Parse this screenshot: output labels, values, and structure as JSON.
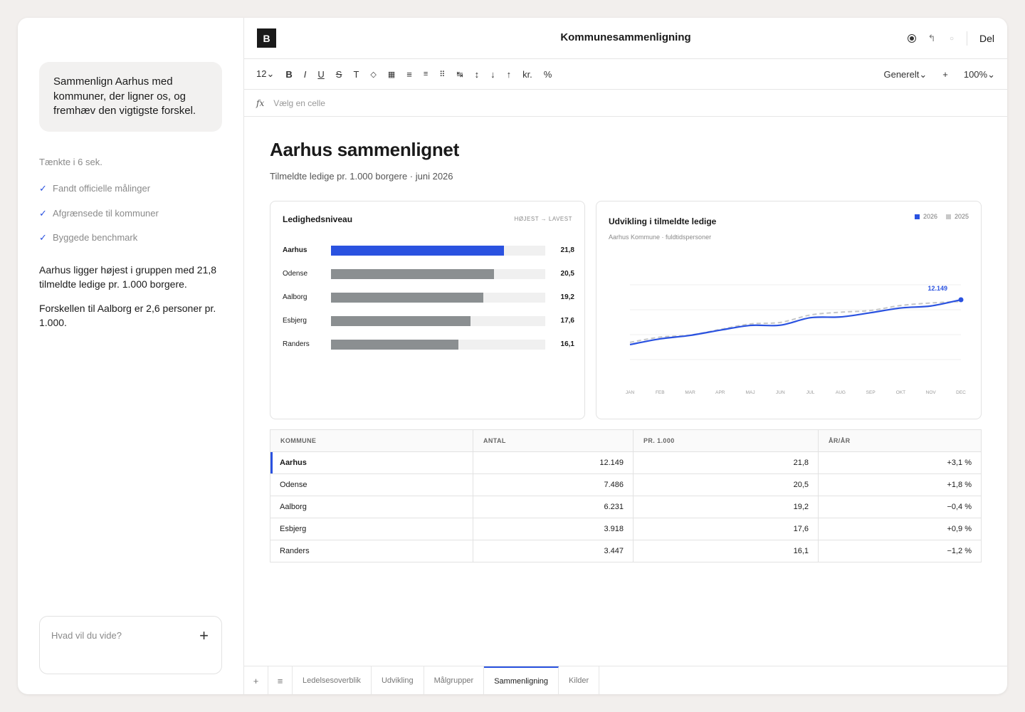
{
  "app": {
    "title": "Kommunesammenligning",
    "logo": "B",
    "share_label": "Del"
  },
  "chat": {
    "prompt": "Sammenlign Aarhus med kommuner, der ligner os, og fremhæv den vigtigste forskel.",
    "thought": "Tænkte i 6 sek.",
    "steps": [
      "Fandt officielle målinger",
      "Afgrænsede til kommuner",
      "Byggede benchmark"
    ],
    "answer": [
      "Aarhus ligger højest i gruppen med 21,8 tilmeldte ledige pr. 1.000 borgere.",
      "Forskellen til Aalborg er 2,6 personer pr. 1.000."
    ],
    "composer_placeholder": "Hvad vil du vide?"
  },
  "toolbar": {
    "font_size": "12⌄",
    "bold": "B",
    "italic": "I",
    "underline": "U",
    "strike": "S",
    "text": "T",
    "fill": "◇",
    "borders": "▦",
    "align_left": "≡",
    "align_center": "≡",
    "merge": "⠿",
    "wrap": "↹",
    "vert": "↕",
    "down": "↓",
    "up": "↑",
    "currency": "kr.",
    "percent": "%",
    "format": "Generelt⌄",
    "add": "+",
    "zoom": "100%⌄"
  },
  "formula": {
    "fx": "fx",
    "placeholder": "Vælg en celle"
  },
  "page": {
    "title": "Aarhus sammenlignet",
    "subtitle": "Tilmeldte ledige pr. 1.000 borgere · juni 2026"
  },
  "bar_card": {
    "title": "Ledighedsniveau",
    "note": "HØJEST → LAVEST"
  },
  "line_card": {
    "title": "Udvikling i tilmeldte ledige",
    "subtitle": "Aarhus Kommune · fuldtidspersoner",
    "end_label": "12.149"
  },
  "chart_data": [
    {
      "type": "bar",
      "title": "Ledighedsniveau",
      "categories": [
        "Aarhus",
        "Odense",
        "Aalborg",
        "Esbjerg",
        "Randers"
      ],
      "values": [
        21.8,
        20.5,
        19.2,
        17.6,
        16.1
      ],
      "value_labels": [
        "21,8",
        "20,5",
        "19,2",
        "17,6",
        "16,1"
      ],
      "xlim": [
        0,
        27
      ],
      "highlight": "Aarhus",
      "colors": {
        "highlight": "#2a52e0",
        "default": "#8b8f91",
        "track": "#f0f0f0"
      }
    },
    {
      "type": "line",
      "title": "Udvikling i tilmeldte ledige",
      "x": [
        "JAN",
        "FEB",
        "MAR",
        "APR",
        "MAJ",
        "JUN",
        "JUL",
        "AUG",
        "SEP",
        "OKT",
        "NOV",
        "DEC"
      ],
      "series": [
        {
          "name": "2026",
          "color": "#2a52e0",
          "values": [
            10350,
            10580,
            10720,
            10930,
            11120,
            11130,
            11430,
            11460,
            11630,
            11820,
            11900,
            12149
          ]
        },
        {
          "name": "2025",
          "color": "#c4c6c8",
          "dashed": true,
          "values": [
            10440,
            10650,
            10730,
            10960,
            11180,
            11240,
            11540,
            11650,
            11720,
            11920,
            12020,
            12080
          ]
        }
      ],
      "ylim": [
        9750,
        12750
      ],
      "grid": true,
      "legend": "top-right"
    }
  ],
  "table": {
    "headers": [
      "KOMMUNE",
      "ANTAL",
      "PR. 1.000",
      "ÅR/ÅR"
    ],
    "rows": [
      [
        "Aarhus",
        "12.149",
        "21,8",
        "+3,1 %"
      ],
      [
        "Odense",
        "7.486",
        "20,5",
        "+1,8 %"
      ],
      [
        "Aalborg",
        "6.231",
        "19,2",
        "−0,4 %"
      ],
      [
        "Esbjerg",
        "3.918",
        "17,6",
        "+0,9 %"
      ],
      [
        "Randers",
        "3.447",
        "16,1",
        "−1,2 %"
      ]
    ]
  },
  "tabs": {
    "add": "+",
    "menu": "≡",
    "items": [
      "Ledelsesoverblik",
      "Udvikling",
      "Målgrupper",
      "Sammenligning",
      "Kilder"
    ],
    "active": "Sammenligning"
  }
}
